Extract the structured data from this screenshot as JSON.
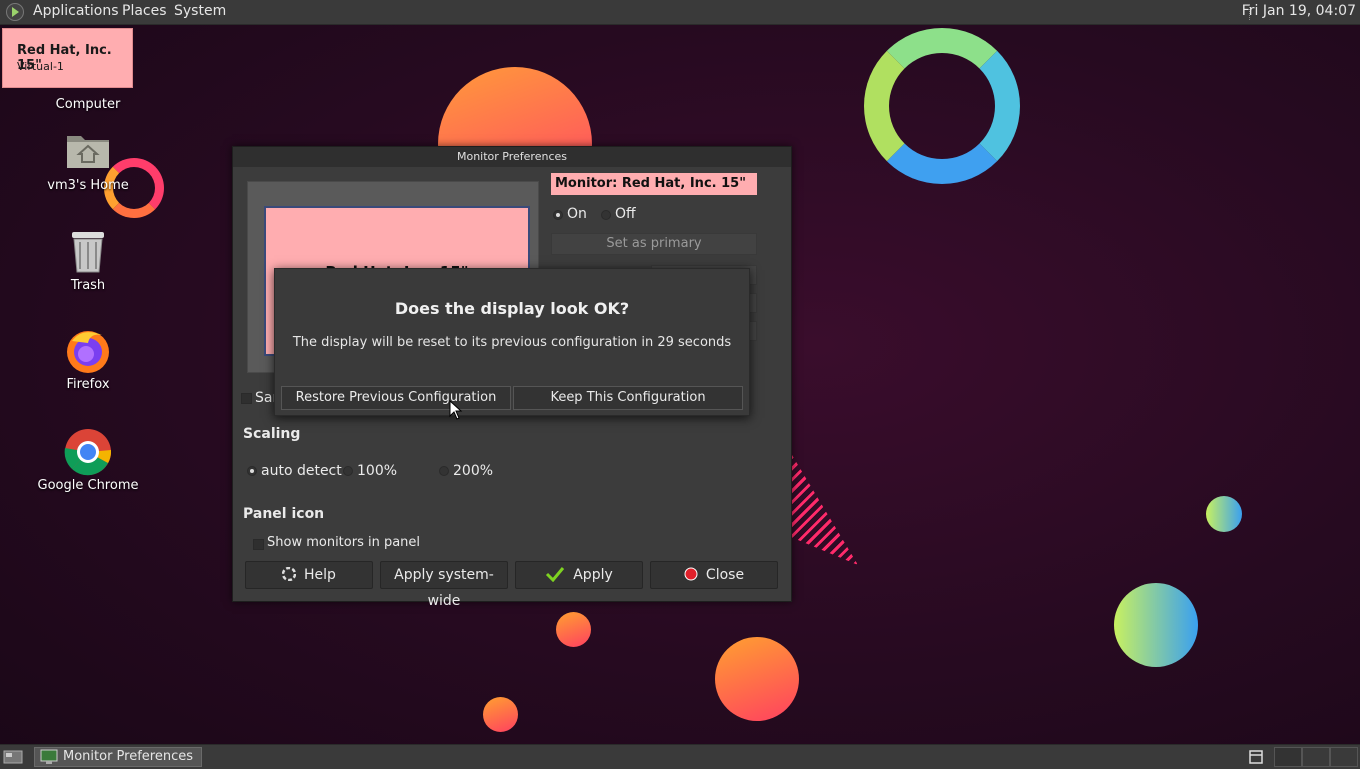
{
  "top_panel": {
    "menus": [
      "Applications",
      "Places",
      "System"
    ],
    "clock": "Fri Jan 19, 04:07"
  },
  "osd": {
    "monitor_name": "Red Hat, Inc. 15\"",
    "output": "Virtual-1"
  },
  "desktop_icons": [
    {
      "label": "Computer",
      "icon": "computer-icon"
    },
    {
      "label": "vm3's Home",
      "icon": "home-folder-icon"
    },
    {
      "label": "Trash",
      "icon": "trash-icon"
    },
    {
      "label": "Firefox",
      "icon": "firefox-icon"
    },
    {
      "label": "Google Chrome",
      "icon": "chrome-icon"
    }
  ],
  "window": {
    "title": "Monitor Preferences",
    "preview_label": "Red Hat, Inc. 15\"",
    "monitor_label": "Monitor: Red Hat, Inc. 15\"",
    "power": {
      "on_label": "On",
      "off_label": "Off",
      "selected": "On"
    },
    "set_primary_label": "Set as primary",
    "same_image_label_partial": "Sar",
    "scaling": {
      "heading": "Scaling",
      "options": [
        "auto detect",
        "100%",
        "200%"
      ],
      "selected": "auto detect"
    },
    "panel_icon": {
      "heading": "Panel icon",
      "show_monitors_label": "Show monitors in panel",
      "checked": false
    },
    "buttons": {
      "help": "Help",
      "apply_system_wide": "Apply system-wide",
      "apply": "Apply",
      "close": "Close"
    }
  },
  "dialog": {
    "title": "Does the display look OK?",
    "message": "The display will be reset to its previous configuration in 29 seconds",
    "restore_label": "Restore Previous Configuration",
    "keep_label": "Keep This Configuration"
  },
  "taskbar": {
    "tasks": [
      {
        "label": "Monitor Preferences",
        "icon": "monitor-prefs-icon"
      }
    ]
  },
  "colors": {
    "accent_pink": "#ffadb0",
    "panel_bg": "#3a3a3a",
    "window_bg": "#3c3c3c"
  }
}
